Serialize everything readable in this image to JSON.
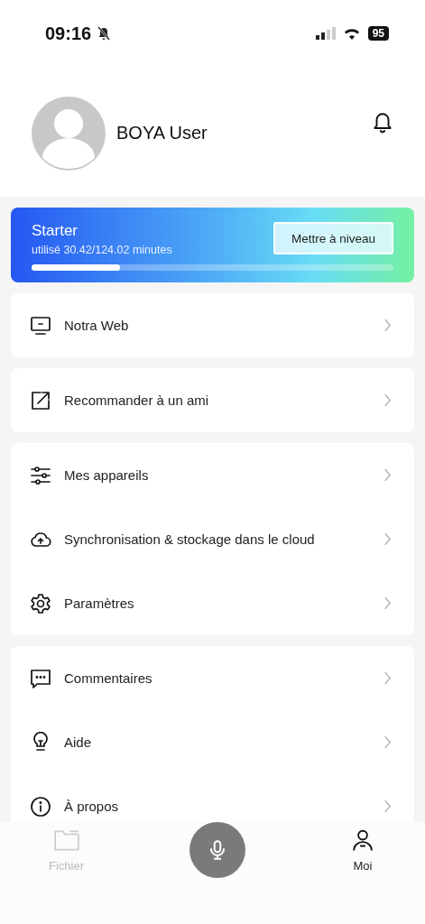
{
  "status_bar": {
    "time": "09:16",
    "battery": "95"
  },
  "profile": {
    "name": "BOYA User"
  },
  "plan": {
    "name": "Starter",
    "usage": "utilisé 30.42/124.02 minutes",
    "level": 0.245,
    "button": "Mettre à niveau"
  },
  "groups": [
    {
      "items": [
        {
          "kind": "monitor",
          "label": "Notra Web"
        }
      ]
    },
    {
      "items": [
        {
          "kind": "share",
          "label": "Recommander à un ami"
        }
      ]
    },
    {
      "items": [
        {
          "kind": "sliders",
          "label": "Mes appareils"
        },
        {
          "kind": "cloud",
          "label": "Synchronisation & stockage dans le cloud"
        },
        {
          "kind": "gear",
          "label": "Paramètres"
        }
      ]
    },
    {
      "items": [
        {
          "kind": "chat",
          "label": "Commentaires"
        },
        {
          "kind": "bulb",
          "label": "Aide"
        },
        {
          "kind": "info",
          "label": "À propos"
        }
      ]
    }
  ],
  "tab_bar": [
    {
      "kind": "folder",
      "label": "Fichier",
      "selected": false
    },
    {
      "kind": "mic"
    },
    {
      "kind": "person",
      "label": "Moi",
      "selected": true
    }
  ]
}
